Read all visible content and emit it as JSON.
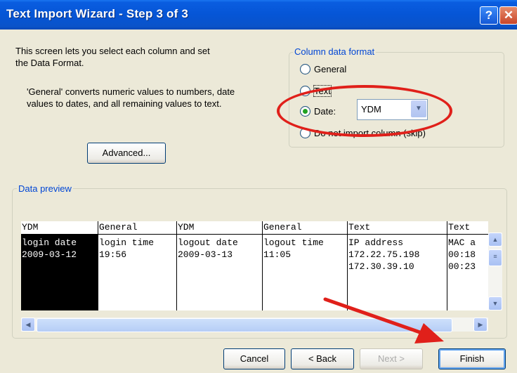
{
  "window": {
    "title": "Text Import Wizard - Step 3 of 3"
  },
  "description": {
    "line1": "This screen lets you select each column and set",
    "line2": "the Data Format.",
    "note1": "'General' converts numeric values to numbers, date",
    "note2": "values to dates, and all remaining values to text."
  },
  "column_format": {
    "legend": "Column data format",
    "options": [
      "General",
      "Text",
      "Date:",
      "Do not import column (skip)"
    ],
    "selected": "Date:",
    "date_value": "YDM"
  },
  "advanced_button": "Advanced...",
  "preview": {
    "legend": "Data preview",
    "columns": [
      {
        "format": "YDM",
        "rows": [
          "login date",
          "2009-03-12"
        ]
      },
      {
        "format": "General",
        "rows": [
          "login time",
          "19:56"
        ]
      },
      {
        "format": "YDM",
        "rows": [
          "logout date",
          "2009-03-13"
        ]
      },
      {
        "format": "General",
        "rows": [
          "logout time",
          "11:05"
        ]
      },
      {
        "format": "Text",
        "rows": [
          "IP address",
          "172.22.75.198",
          "172.30.39.10"
        ]
      },
      {
        "format": "Text",
        "rows": [
          "MAC a",
          "00:18",
          "00:23"
        ]
      }
    ]
  },
  "buttons": {
    "cancel": "Cancel",
    "back": "< Back",
    "next": "Next >",
    "finish": "Finish"
  },
  "colors": {
    "titlebar": "#0555d6",
    "annotation": "#e0201a",
    "accent": "#0046d5"
  }
}
